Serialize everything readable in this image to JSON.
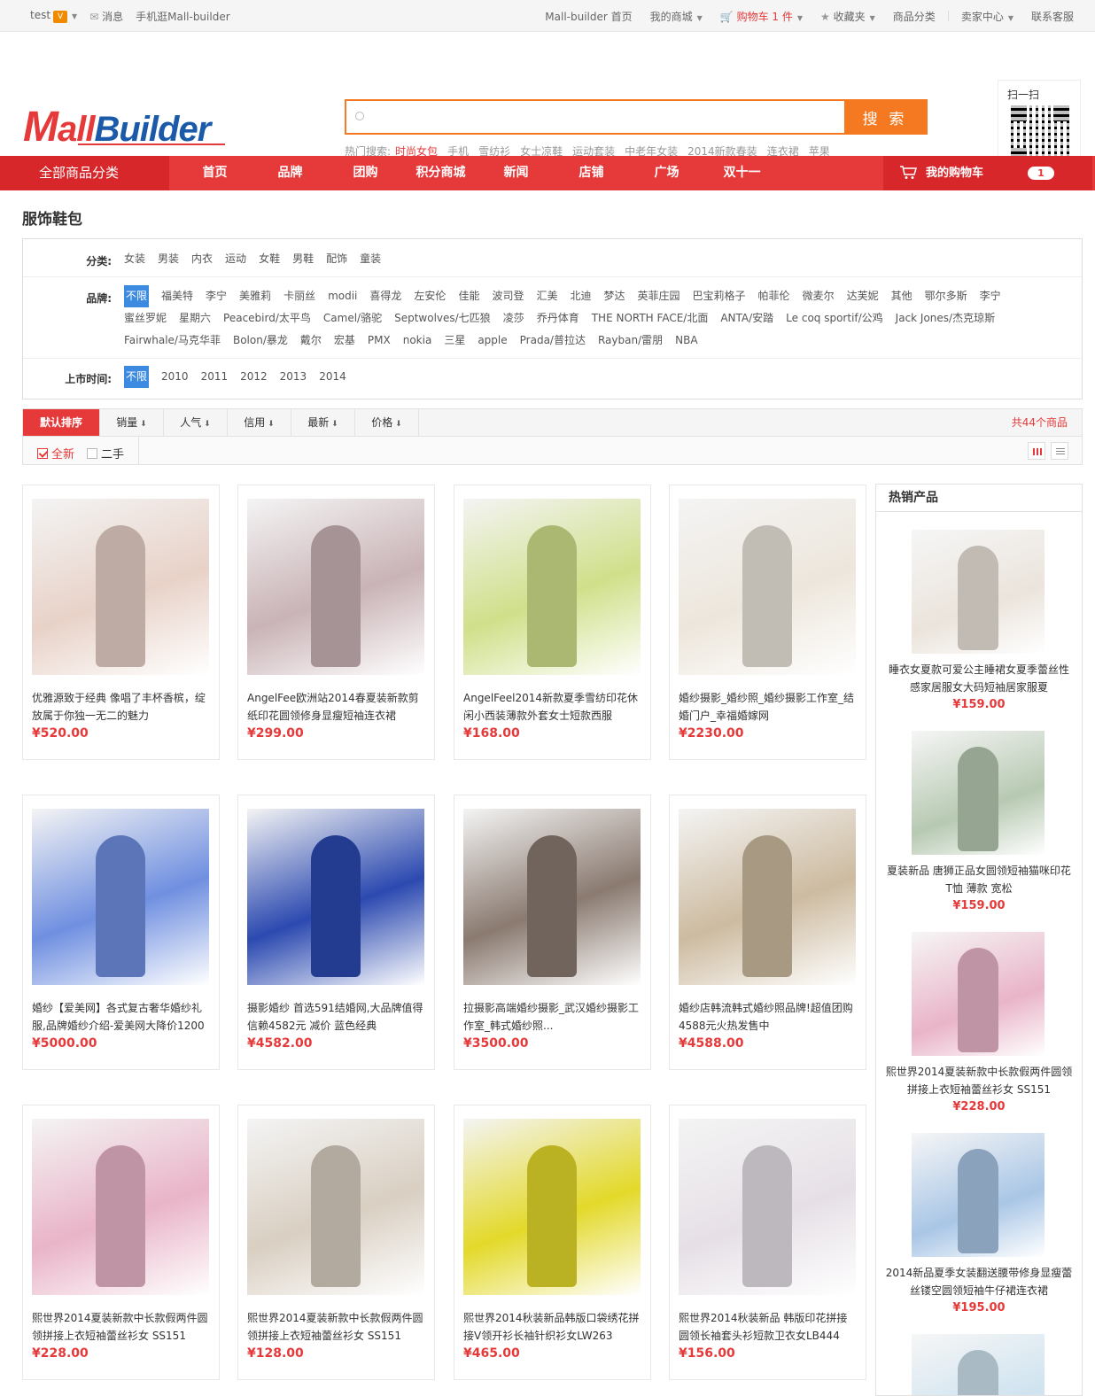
{
  "topbar": {
    "user": "test",
    "vip": "V",
    "messages": "消息",
    "mobile": "手机逛Mall-builder",
    "home": "Mall-builder 首页",
    "my_mall": "我的商城",
    "cart": "购物车 1 件",
    "favorites": "收藏夹",
    "categories": "商品分类",
    "seller": "卖家中心",
    "service": "联系客服"
  },
  "header": {
    "search_button": "搜 索",
    "search_placeholder": "",
    "hot_label": "热门搜索:",
    "hot_words": [
      "时尚女包",
      "手机",
      "雪纺衫",
      "女士凉鞋",
      "运动套装",
      "中老年女装",
      "2014新款春装",
      "连衣裙",
      "苹果"
    ],
    "qr_label": "扫一扫"
  },
  "nav": {
    "all_categories": "全部商品分类",
    "items": [
      "首页",
      "品牌",
      "团购",
      "积分商城",
      "新闻",
      "店铺",
      "广场",
      "双十一"
    ],
    "cart": "我的购物车",
    "cart_count": "1"
  },
  "page_title": "服饰鞋包",
  "filters": {
    "category_label": "分类:",
    "categories": [
      "女装",
      "男装",
      "内衣",
      "运动",
      "女鞋",
      "男鞋",
      "配饰",
      "童装"
    ],
    "brand_label": "品牌:",
    "brands": [
      "不限",
      "福美特",
      "李宁",
      "美雅莉",
      "卡丽丝",
      "modii",
      "喜得龙",
      "左安伦",
      "佳能",
      "波司登",
      "汇美",
      "北迪",
      "梦达",
      "英菲庄园",
      "巴宝莉格子",
      "帕菲伦",
      "微麦尔",
      "达芙妮",
      "其他",
      "鄂尔多斯",
      "李宁",
      "蜜丝罗妮",
      "星期六",
      "Peacebird/太平鸟",
      "Camel/骆驼",
      "Septwolves/七匹狼",
      "凌莎",
      "乔丹体育",
      "THE NORTH FACE/北面",
      "ANTA/安踏",
      "Le coq sportif/公鸡",
      "Jack Jones/杰克琼斯",
      "Fairwhale/马克华菲",
      "Bolon/暴龙",
      "戴尔",
      "宏基",
      "PMX",
      "nokia",
      "三星",
      "apple",
      "Prada/普拉达",
      "Rayban/雷朋",
      "NBA"
    ],
    "year_label": "上市时间:",
    "years": [
      "不限",
      "2010",
      "2011",
      "2012",
      "2013",
      "2014"
    ]
  },
  "sort": {
    "options": [
      "默认排序",
      "销量",
      "人气",
      "信用",
      "最新",
      "价格"
    ],
    "total": "共44个商品",
    "new_label": "全新",
    "used_label": "二手"
  },
  "products": [
    {
      "name": "优雅源致于经典 像唱了丰杯香槟，绽放属于你独一无二的魅力",
      "price": "¥520.00",
      "color": "#e8d2c8"
    },
    {
      "name": "AngelFee欧洲站2014春夏装新款剪纸印花圆领修身显瘦短袖连衣裙",
      "price": "¥299.00",
      "color": "#c9b3b6"
    },
    {
      "name": "AngelFeel2014新款夏季雪纺印花休闲小西装薄款外套女士短款西服",
      "price": "¥168.00",
      "color": "#cfe08a"
    },
    {
      "name": "婚纱摄影_婚纱照_婚纱摄影工作室_结婚门户_幸福婚嫁网",
      "price": "¥2230.00",
      "color": "#ede6dc"
    },
    {
      "name": "婚纱【爱美网】各式复古奢华婚纱礼服,品牌婚纱介绍-爱美网大降价1200",
      "price": "¥5000.00",
      "color": "#6f8fe0"
    },
    {
      "name": "摄影婚纱 首选591结婚网,大品牌值得信赖4582元 减价 蓝色经典",
      "price": "¥4582.00",
      "color": "#2b49b0"
    },
    {
      "name": "拉摄影高端婚纱摄影_武汉婚纱摄影工作室_韩式婚纱照...",
      "price": "¥3500.00",
      "color": "#8a7a70"
    },
    {
      "name": "婚纱店韩流韩式婚纱照品牌!超值团购4588元火热发售中",
      "price": "¥4588.00",
      "color": "#cdbba0"
    },
    {
      "name": "熙世界2014夏装新款中长款假两件圆领拼接上衣短袖蕾丝衫女 SS151",
      "price": "¥228.00",
      "color": "#e9b4c8"
    },
    {
      "name": "熙世界2014夏装新款中长款假两件圆领拼接上衣短袖蕾丝衫女 SS151",
      "price": "¥128.00",
      "color": "#d9cfc2"
    },
    {
      "name": "熙世界2014秋装新品韩版口袋绣花拼接V领开衫长袖针织衫女LW263",
      "price": "¥465.00",
      "color": "#e3d92a"
    },
    {
      "name": "熙世界2014秋装新品 韩版印花拼接圆领长袖套头衫短款卫衣女LB444",
      "price": "¥156.00",
      "color": "#e6e0e6"
    }
  ],
  "sidebar": {
    "title": "热销产品",
    "items": [
      {
        "name": "睡衣女夏款可爱公主睡裙女夏季蕾丝性感家居服女大码短袖居家服夏",
        "price": "¥159.00",
        "color": "#ebe4dc"
      },
      {
        "name": "夏装新品 唐狮正品女圆领短袖猫咪印花T恤 薄款 宽松",
        "price": "¥159.00",
        "color": "#b7c9b2"
      },
      {
        "name": "熙世界2014夏装新款中长款假两件圆领拼接上衣短袖蕾丝衫女 SS151",
        "price": "¥228.00",
        "color": "#e9b4c8"
      },
      {
        "name": "2014新品夏季女装翻送腰带修身显瘦蕾丝镂空圆领短袖牛仔裙连衣裙",
        "price": "¥195.00",
        "color": "#a9c6e6"
      },
      {
        "name": "",
        "price": "",
        "color": "#cfe3f0"
      }
    ]
  }
}
